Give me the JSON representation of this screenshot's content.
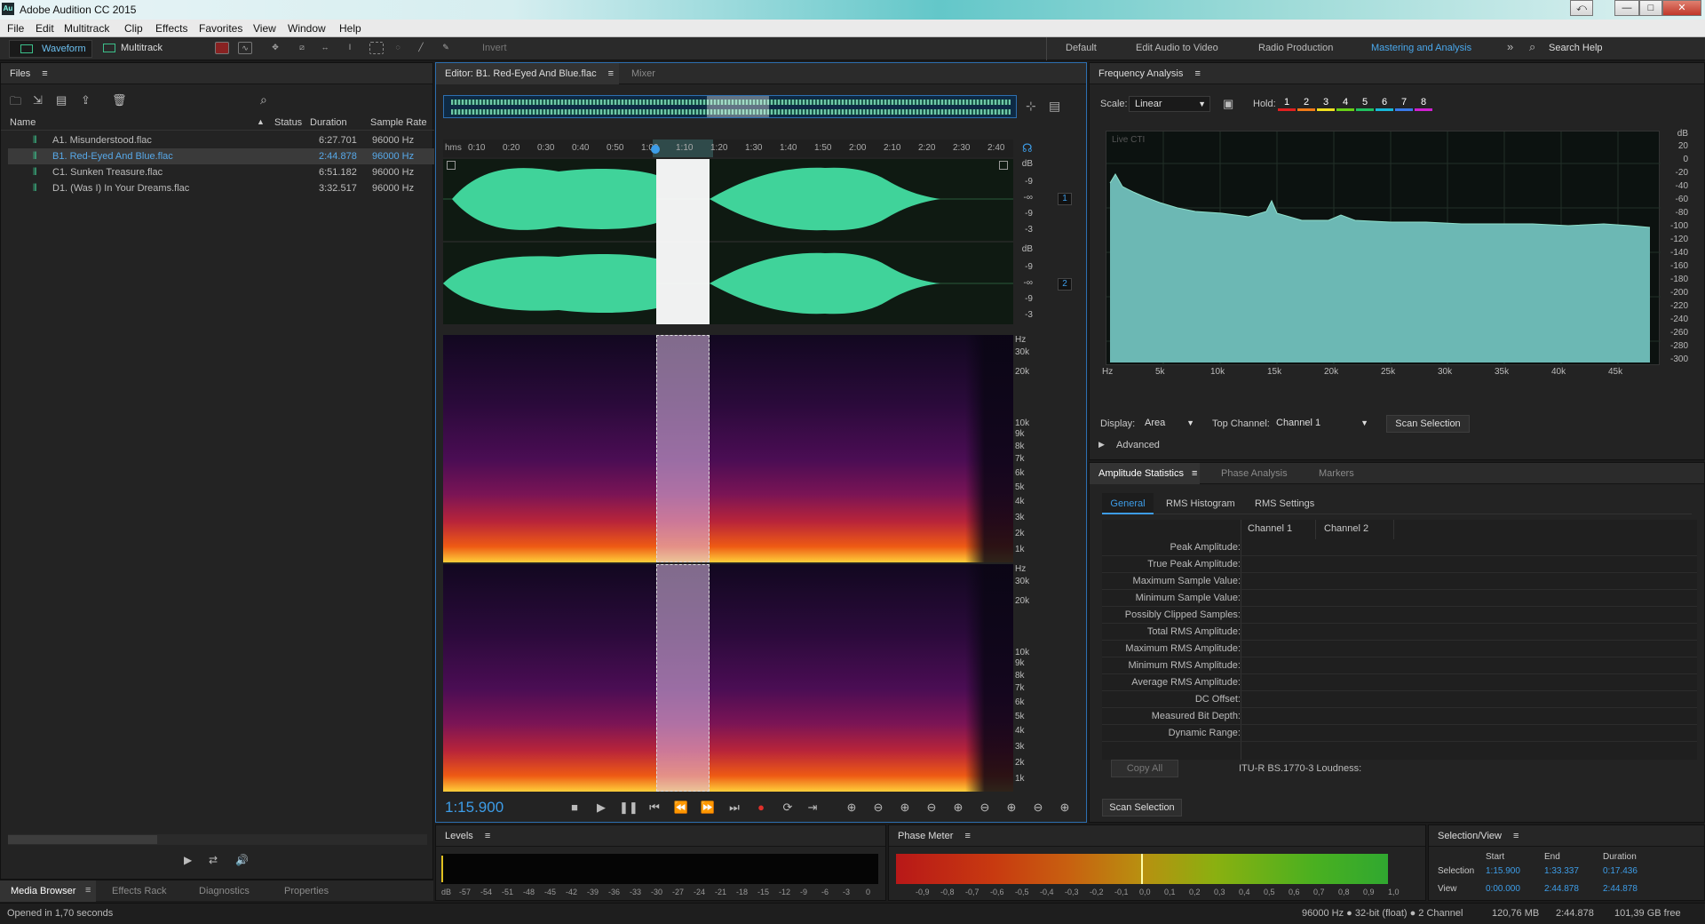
{
  "app": {
    "title": "Adobe Audition CC 2015",
    "logo": "Au"
  },
  "window_controls": {
    "extra": "⤺",
    "minimize": "—",
    "maximize": "□",
    "close": "✕"
  },
  "menu": [
    "File",
    "Edit",
    "Multitrack",
    "Clip",
    "Effects",
    "Favorites",
    "View",
    "Window",
    "Help"
  ],
  "toolbar": {
    "waveform_label": "Waveform",
    "multitrack_label": "Multitrack",
    "invert_label": "Invert",
    "workspaces": [
      "Default",
      "Edit Audio to Video",
      "Radio Production",
      "Mastering and Analysis"
    ],
    "active_workspace": "Mastering and Analysis",
    "more": "»",
    "search_label": "Search Help"
  },
  "files": {
    "title": "Files",
    "columns": {
      "name": "Name",
      "status": "Status",
      "duration": "Duration",
      "rate": "Sample Rate"
    },
    "items": [
      {
        "name": "A1. Misunderstood.flac",
        "duration": "6:27.701",
        "rate": "96000 Hz"
      },
      {
        "name": "B1. Red-Eyed And Blue.flac",
        "duration": "2:44.878",
        "rate": "96000 Hz",
        "selected": true
      },
      {
        "name": "C1. Sunken Treasure.flac",
        "duration": "6:51.182",
        "rate": "96000 Hz"
      },
      {
        "name": "D1. (Was I) In Your Dreams.flac",
        "duration": "3:32.517",
        "rate": "96000 Hz"
      }
    ]
  },
  "bottom_tabs": [
    "Media Browser",
    "Effects Rack",
    "Diagnostics",
    "Properties"
  ],
  "editor": {
    "tab_label": "Editor: B1. Red-Eyed And Blue.flac",
    "mixer_label": "Mixer",
    "ruler_unit": "hms",
    "ruler": [
      "0:10",
      "0:20",
      "0:30",
      "0:40",
      "0:50",
      "1:00",
      "1:10",
      "1:20",
      "1:30",
      "1:40",
      "1:50",
      "2:00",
      "2:10",
      "2:20",
      "2:30",
      "2:40"
    ],
    "db_scale": [
      "dB",
      "-9",
      "-∞",
      "-9",
      "-3"
    ],
    "channel1": "1",
    "channel2": "2",
    "hz_scale": [
      "Hz",
      "30k",
      "20k",
      "10k",
      "9k",
      "8k",
      "7k",
      "6k",
      "5k",
      "4k",
      "3k",
      "2k",
      "1k"
    ],
    "time": "1:15.900"
  },
  "transport": [
    "■",
    "▶",
    "❚❚",
    "⏮",
    "⏪",
    "⏩",
    "⏭",
    "●",
    "⟳",
    "⇥"
  ],
  "zoom_icons": [
    "⊕",
    "⊖",
    "⊕",
    "⊖",
    "⊕",
    "⊖",
    "⊕",
    "⊖",
    "⊕",
    "⊖"
  ],
  "freq": {
    "title": "Frequency Analysis",
    "scale_label": "Scale:",
    "scale_value": "Linear",
    "hold_label": "Hold:",
    "holds": [
      "1",
      "2",
      "3",
      "4",
      "5",
      "6",
      "7",
      "8"
    ],
    "hold_colors": [
      "#e02020",
      "#f07a18",
      "#f0e020",
      "#68d018",
      "#20c060",
      "#18b8d8",
      "#3a7ae8",
      "#d020d0"
    ],
    "live": "Live CTI",
    "db_axis": [
      "dB",
      "20",
      "0",
      "-20",
      "-40",
      "-60",
      "-80",
      "-100",
      "-120",
      "-140",
      "-160",
      "-180",
      "-200",
      "-220",
      "-240",
      "-260",
      "-280",
      "-300"
    ],
    "hz_axis": [
      "Hz",
      "5k",
      "10k",
      "15k",
      "20k",
      "25k",
      "30k",
      "35k",
      "40k",
      "45k"
    ],
    "display_label": "Display:",
    "display_value": "Area",
    "top_channel_label": "Top Channel:",
    "top_channel_value": "Channel 1",
    "scan_selection": "Scan Selection",
    "advanced": "Advanced"
  },
  "amp": {
    "tabs": [
      "Amplitude Statistics",
      "Phase Analysis",
      "Markers"
    ],
    "subtabs": [
      "General",
      "RMS Histogram",
      "RMS Settings"
    ],
    "ch1": "Channel 1",
    "ch2": "Channel 2",
    "rows": [
      "Peak Amplitude:",
      "True Peak Amplitude:",
      "Maximum Sample Value:",
      "Minimum Sample Value:",
      "Possibly Clipped Samples:",
      "Total RMS Amplitude:",
      "Maximum RMS Amplitude:",
      "Minimum RMS Amplitude:",
      "Average RMS Amplitude:",
      "DC Offset:",
      "Measured Bit Depth:",
      "Dynamic Range:"
    ],
    "copy_all": "Copy All",
    "loudness": "ITU-R BS.1770-3 Loudness:",
    "scan_selection": "Scan Selection"
  },
  "levels": {
    "title": "Levels",
    "ticks": [
      "dB",
      "-57",
      "-54",
      "-51",
      "-48",
      "-45",
      "-42",
      "-39",
      "-36",
      "-33",
      "-30",
      "-27",
      "-24",
      "-21",
      "-18",
      "-15",
      "-12",
      "-9",
      "-6",
      "-3",
      "0"
    ]
  },
  "phase": {
    "title": "Phase Meter",
    "ticks": [
      "-0,9",
      "-0,8",
      "-0,7",
      "-0,6",
      "-0,5",
      "-0,4",
      "-0,3",
      "-0,2",
      "-0,1",
      "0,0",
      "0,1",
      "0,2",
      "0,3",
      "0,4",
      "0,5",
      "0,6",
      "0,7",
      "0,8",
      "0,9",
      "1,0"
    ]
  },
  "selview": {
    "title": "Selection/View",
    "start": "Start",
    "end": "End",
    "duration": "Duration",
    "selection_label": "Selection",
    "view_label": "View",
    "sel_start": "1:15.900",
    "sel_end": "1:33.337",
    "sel_dur": "0:17.436",
    "view_start": "0:00.000",
    "view_end": "2:44.878",
    "view_dur": "2:44.878"
  },
  "status": {
    "left": "Opened in 1,70 seconds",
    "format": "96000 Hz ● 32-bit (float) ● 2 Channel",
    "size": "120,76 MB",
    "duration": "2:44.878",
    "free": "101,39 GB free"
  }
}
